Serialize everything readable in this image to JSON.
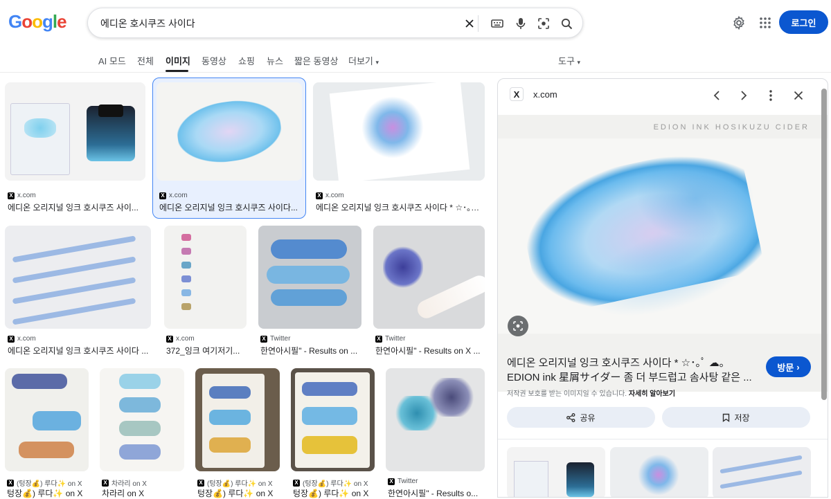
{
  "search": {
    "query": "에디온 호시쿠즈 사이다"
  },
  "header": {
    "login_label": "로그인",
    "logo_letters": [
      "G",
      "o",
      "o",
      "g",
      "l",
      "e"
    ]
  },
  "tabs": [
    {
      "label": "AI 모드"
    },
    {
      "label": "전체"
    },
    {
      "label": "이미지"
    },
    {
      "label": "동영상"
    },
    {
      "label": "쇼핑"
    },
    {
      "label": "뉴스"
    },
    {
      "label": "짧은 동영상"
    },
    {
      "label": "더보기"
    },
    {
      "label": "도구"
    }
  ],
  "results": [
    {
      "source": "x.com",
      "title": "에디온 오리지널 잉크 호시쿠즈 사이..."
    },
    {
      "source": "x.com",
      "title": "에디온 오리지널 잉크 호시쿠즈 사이다..."
    },
    {
      "source": "x.com",
      "title": "에디온 오리지널 잉크 호시쿠즈 사이다 * ☆･｡ﾟ..."
    },
    {
      "source": "x.com",
      "title": "에디온 오리지널 잉크 호시쿠즈 사이다 ..."
    },
    {
      "source": "x.com",
      "title": "372_잉크 여기저기..."
    },
    {
      "source": "Twitter",
      "title": "한연아시필\" - Results on ..."
    },
    {
      "source": "Twitter",
      "title": "한연아시필\" - Results on X ..."
    },
    {
      "source": "(텅장💰) 루다✨ on X",
      "title": "텅장💰) 루다✨ on X"
    },
    {
      "source": "차라리 on X",
      "title": "차라리 on X"
    },
    {
      "source": "(텅장💰) 루다✨ on X",
      "title": "텅장💰) 루다✨ on X"
    },
    {
      "source": "(텅장💰) 루다✨ on X",
      "title": "텅장💰) 루다✨ on X"
    },
    {
      "source": "Twitter",
      "title": "한연아시필\" - Results o..."
    }
  ],
  "panel": {
    "source": "x.com",
    "image_caption": "EDION INK HOSIKUZU CIDER",
    "title_line1": "에디온 오리지널 잉크 호시쿠즈 사이다 * ☆･｡ﾟ ☁｡",
    "title_line2": "EDION ink 星屑サイダー 좀 더 부드럽고 솜사탕 같은 ...",
    "visit_label": "방문",
    "copyright_text": "저작권 보호를 받는 이미지일 수 있습니다.",
    "learn_more": "자세히 알아보기",
    "share_label": "공유",
    "save_label": "저장"
  },
  "colors": {
    "accent": "#0b57d0",
    "selected_border": "#4285f4"
  }
}
